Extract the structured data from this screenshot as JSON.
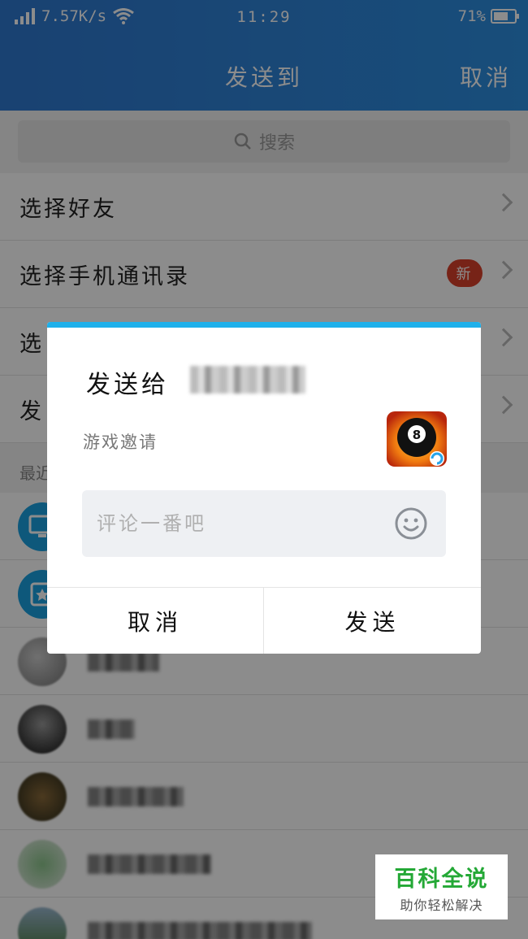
{
  "status_bar": {
    "speed": "7.57K/s",
    "time": "11:29",
    "battery_text": "71%",
    "battery_level": 0.71
  },
  "header": {
    "title": "发送到",
    "cancel": "取消"
  },
  "search": {
    "placeholder": "搜索"
  },
  "menu": {
    "items": [
      {
        "label": "选择好友"
      },
      {
        "label": "选择手机通讯录",
        "badge": "新"
      },
      {
        "label": "选"
      },
      {
        "label": "发"
      }
    ]
  },
  "recent": {
    "label": "最近"
  },
  "dialog": {
    "title": "发送给",
    "description": "游戏邀请",
    "app_icon": "8-ball-icon",
    "comment_placeholder": "评论一番吧",
    "cancel": "取消",
    "send": "发送",
    "accent_color": "#1fb0ea"
  },
  "watermark": {
    "title": "百科全说",
    "subtitle": "助你轻松解决"
  }
}
